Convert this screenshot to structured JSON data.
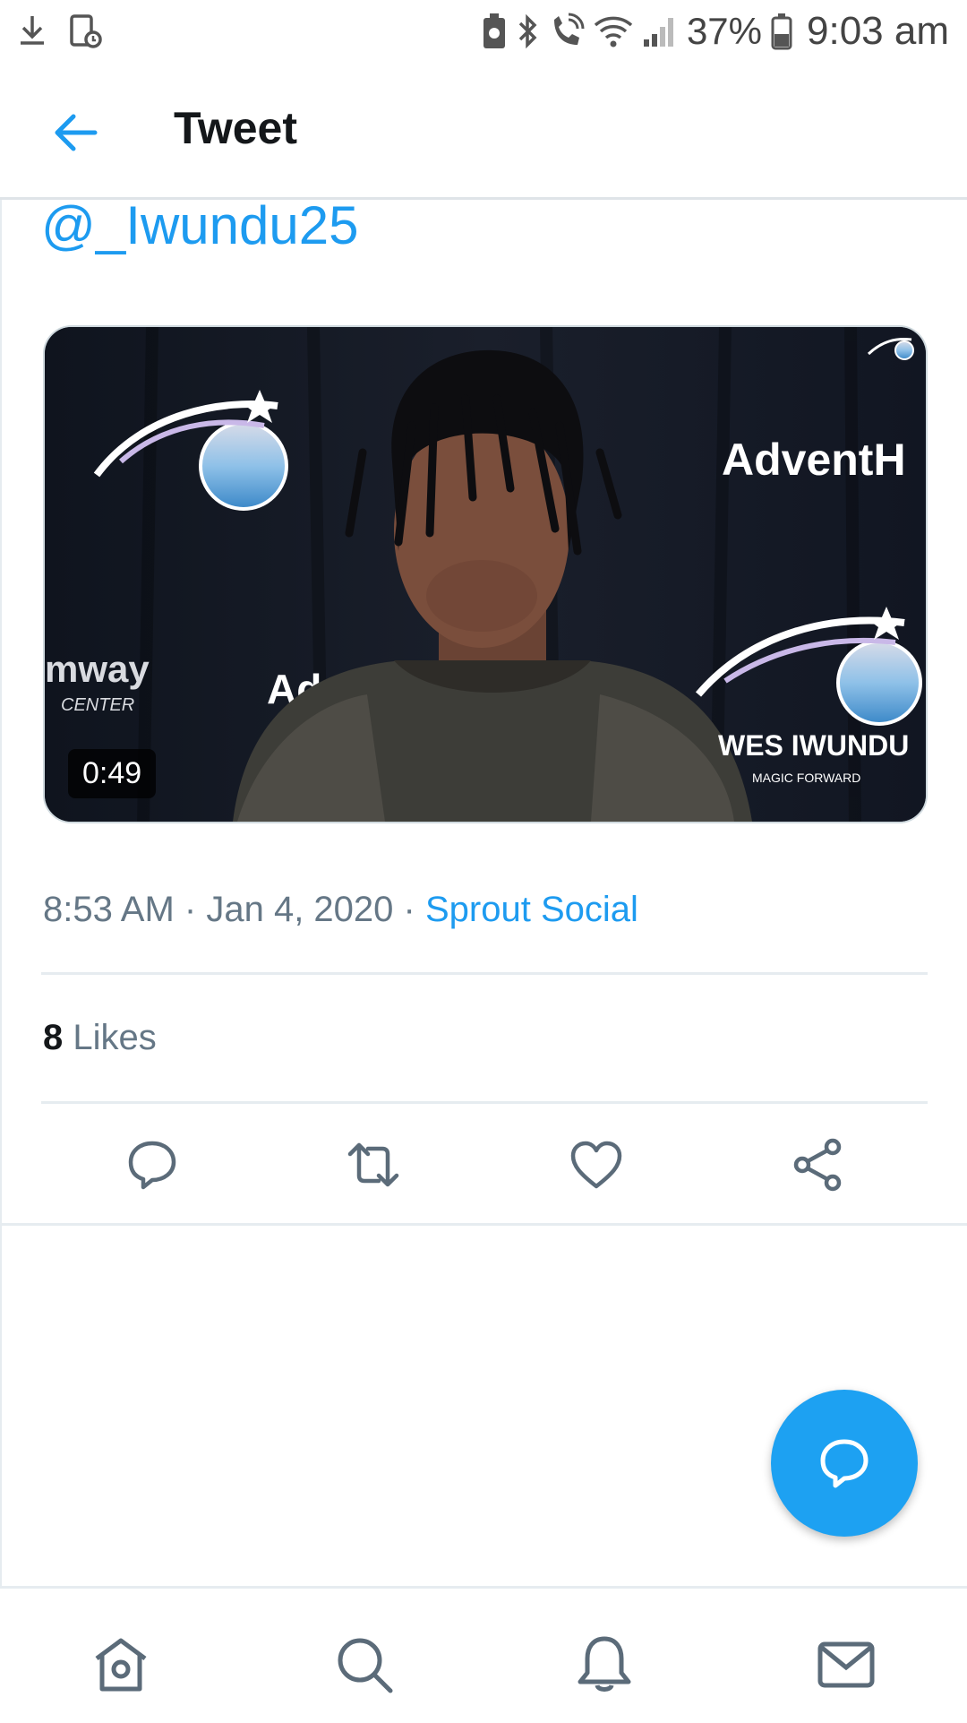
{
  "status_bar": {
    "battery_percent": "37%",
    "time": "9:03 am",
    "left_icons": [
      "download-icon",
      "screen-lock-icon"
    ],
    "right_icons": [
      "battery-saver-icon",
      "bluetooth-icon",
      "wifi-calling-icon",
      "wifi-icon",
      "signal-icon",
      "battery-icon"
    ]
  },
  "header": {
    "title": "Tweet",
    "back_icon": "back-arrow-icon"
  },
  "tweet": {
    "mention": "@_Iwundu25",
    "video": {
      "duration": "0:49",
      "overlay_texts": [
        "AdventH",
        "Adv",
        "mway",
        "CENTER",
        "WES IWUNDU",
        "MAGIC FORWARD"
      ]
    },
    "time": "8:53 AM",
    "separator": "·",
    "date": "Jan 4, 2020",
    "source": "Sprout Social",
    "likes_count": "8",
    "likes_label": "Likes"
  },
  "actions": [
    "reply-icon",
    "retweet-icon",
    "like-icon",
    "share-icon"
  ],
  "fab": {
    "icon": "reply-icon"
  },
  "bottom_nav": [
    "home-icon",
    "search-icon",
    "notifications-icon",
    "messages-icon"
  ],
  "colors": {
    "accent": "#1d9bf0",
    "fab": "#1da1f2",
    "muted": "#657786",
    "icon": "#5b6b79"
  }
}
